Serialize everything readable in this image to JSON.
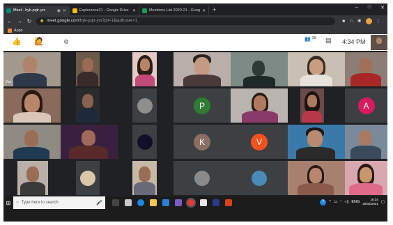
{
  "browser": {
    "tabs": [
      {
        "label": "Meet - hyk-pqtr-yrs",
        "active": true,
        "favicon_color": "#00897b"
      },
      {
        "label": "Explorance21 - Google Drive",
        "active": false,
        "favicon_color": "#fbbc04"
      },
      {
        "label": "Members List 2020-21 - Google",
        "active": false,
        "favicon_color": "#0f9d58"
      }
    ],
    "new_tab": "+",
    "url_host": "meet.google.com",
    "url_path": "/hyk-pqtr-yrs?pli=1&authuser=1",
    "bookmarks_label": "Apps"
  },
  "meet": {
    "time": "4:34 PM",
    "participants_badge": "28",
    "tiles": [
      {
        "kind": "video",
        "label": "You"
      },
      {
        "kind": "video"
      },
      {
        "kind": "video"
      },
      {
        "kind": "video"
      },
      {
        "kind": "video"
      },
      {
        "kind": "video"
      },
      {
        "kind": "video"
      },
      {
        "kind": "video"
      },
      {
        "kind": "video"
      },
      {
        "kind": "avatar_image"
      },
      {
        "kind": "letter",
        "letter": "P",
        "color": "#2e7d32"
      },
      {
        "kind": "video"
      },
      {
        "kind": "video"
      },
      {
        "kind": "letter",
        "letter": "A",
        "color": "#d81b60"
      },
      {
        "kind": "video"
      },
      {
        "kind": "video"
      },
      {
        "kind": "avatar_image"
      },
      {
        "kind": "letter",
        "letter": "K",
        "color": "#8d6e63"
      },
      {
        "kind": "letter",
        "letter": "V",
        "color": "#f4511e"
      },
      {
        "kind": "video"
      },
      {
        "kind": "video"
      },
      {
        "kind": "video"
      },
      {
        "kind": "avatar_image"
      },
      {
        "kind": "video"
      },
      {
        "kind": "avatar_image"
      },
      {
        "kind": "avatar_image"
      },
      {
        "kind": "video"
      },
      {
        "kind": "video"
      }
    ]
  },
  "taskbar": {
    "search_placeholder": "Type here to search",
    "language": "ENG",
    "clock_time": "16:34",
    "clock_date": "26/02/2021"
  }
}
